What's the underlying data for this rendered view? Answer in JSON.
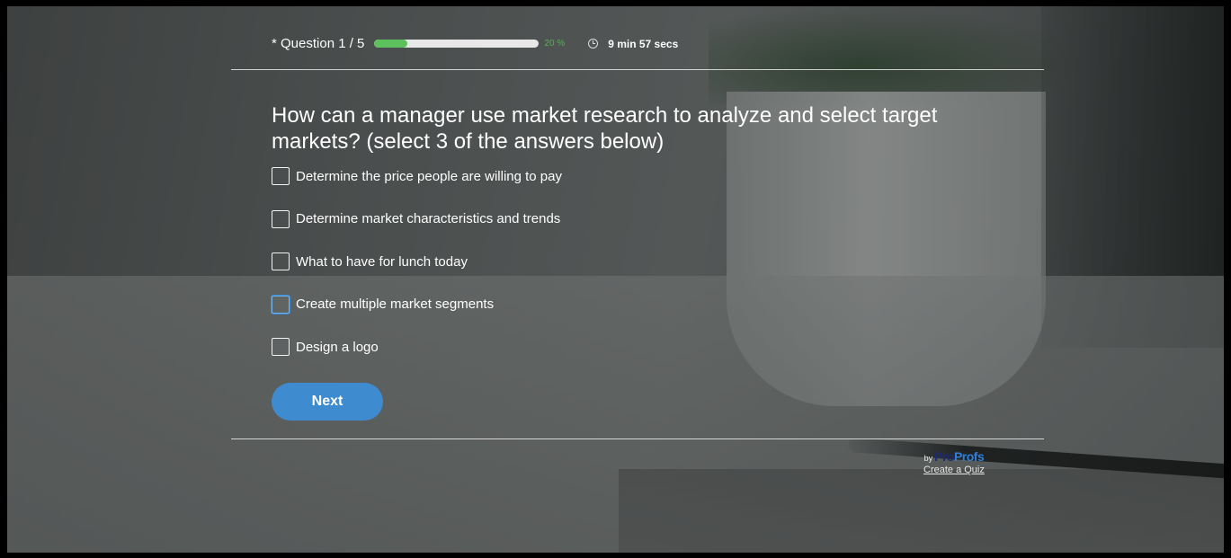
{
  "header": {
    "question_counter": "* Question 1 / 5",
    "progress_percent": 20,
    "progress_label": "20 %",
    "timer": "9 min 57 secs"
  },
  "question": {
    "text": "How can a manager use market research to analyze and select target markets? (select 3 of the answers below)"
  },
  "answers": [
    {
      "label": "Determine the price people are willing to pay",
      "checked": false
    },
    {
      "label": "Determine market characteristics and trends",
      "checked": false
    },
    {
      "label": "What to have for lunch today",
      "checked": false
    },
    {
      "label": "Create multiple market segments",
      "checked": false,
      "focused": true
    },
    {
      "label": "Design a logo",
      "checked": false
    }
  ],
  "next_button": {
    "label": "Next"
  },
  "brand": {
    "by": "by",
    "logo_part1": "Pro",
    "logo_part2": "Profs",
    "create_link": "Create a Quiz"
  },
  "colors": {
    "progress_fill": "#5cc05c",
    "button": "#3f8bd0",
    "focus_border": "#6fb3ea"
  },
  "icons": [
    "clock-icon",
    "checkbox"
  ]
}
